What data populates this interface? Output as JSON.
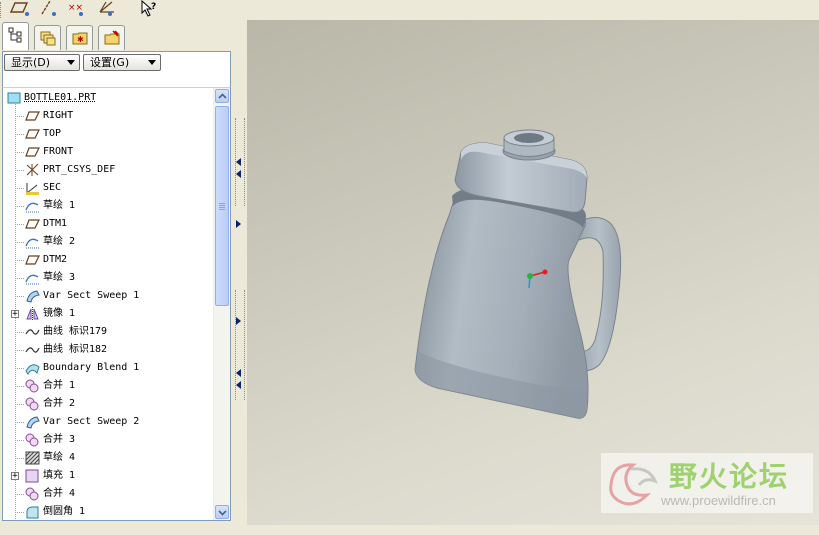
{
  "toolbar": {
    "buttons": [
      "datum-plane-display",
      "datum-axis-display",
      "datum-point-display",
      "coordinate-system-display",
      "context-help"
    ]
  },
  "panel": {
    "tabs": [
      "model-tree",
      "layers",
      "favorites",
      "history"
    ],
    "show_button": "显示(D)",
    "settings_button": "设置(G)"
  },
  "tree": {
    "root": "BOTTLE01.PRT",
    "items": [
      {
        "label": "RIGHT",
        "icon": "datum-plane-icon"
      },
      {
        "label": "TOP",
        "icon": "datum-plane-icon"
      },
      {
        "label": "FRONT",
        "icon": "datum-plane-icon"
      },
      {
        "label": "PRT_CSYS_DEF",
        "icon": "csys-icon"
      },
      {
        "label": "SEC",
        "icon": "section-icon"
      },
      {
        "label": "草绘 1",
        "icon": "sketch-icon"
      },
      {
        "label": "DTM1",
        "icon": "datum-plane-icon"
      },
      {
        "label": "草绘 2",
        "icon": "sketch-icon"
      },
      {
        "label": "DTM2",
        "icon": "datum-plane-icon"
      },
      {
        "label": "草绘 3",
        "icon": "sketch-icon"
      },
      {
        "label": "Var Sect Sweep 1",
        "icon": "sweep-icon"
      },
      {
        "label": "镜像 1",
        "icon": "mirror-icon",
        "expandable": true
      },
      {
        "label": "曲线 标识179",
        "icon": "curve-icon"
      },
      {
        "label": "曲线 标识182",
        "icon": "curve-icon"
      },
      {
        "label": "Boundary Blend 1",
        "icon": "blend-icon"
      },
      {
        "label": "合并 1",
        "icon": "merge-icon"
      },
      {
        "label": "合并 2",
        "icon": "merge-icon"
      },
      {
        "label": "Var Sect Sweep 2",
        "icon": "sweep-icon"
      },
      {
        "label": "合并 3",
        "icon": "merge-icon"
      },
      {
        "label": "草绘 4",
        "icon": "sketch-hatch-icon"
      },
      {
        "label": "填充 1",
        "icon": "fill-icon",
        "expandable": true
      },
      {
        "label": "合并 4",
        "icon": "merge-icon"
      },
      {
        "label": "倒圆角 1",
        "icon": "round-icon"
      }
    ]
  },
  "watermark": {
    "title": "野火论坛",
    "url": "www.proewildfire.cn"
  },
  "colors": {
    "datum": "#b5651d",
    "model_fill": "#a8b2bc",
    "viewport_top": "#b9b7a8",
    "viewport_bottom": "#e6e4d9",
    "watermark_green": "#9fd26f"
  }
}
